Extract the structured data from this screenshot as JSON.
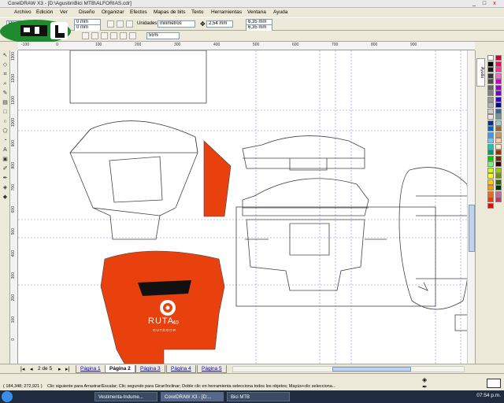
{
  "window": {
    "title": "CorelDRAW X3 - [D:\\Agustin\\Bici MTB\\ALFORIAS.cdr]",
    "minimize": "_",
    "maximize": "□",
    "close": "x"
  },
  "menu": [
    "Archivo",
    "Edición",
    "Ver",
    "Diseño",
    "Organizar",
    "Efectos",
    "Mapas de bits",
    "Texto",
    "Herramientas",
    "Ventana",
    "Ayuda"
  ],
  "property_bar": {
    "preset_label": "Person",
    "width_value": "0 mm",
    "height_value": "0 mm",
    "units_label": "Unidades:",
    "units_value": "milímetros",
    "nudge_value": "2,54 mm",
    "dup_x": "6,35 mm",
    "dup_y": "6,35 mm",
    "zoom_value": "55%"
  },
  "hruler_ticks": [
    "-100",
    "0",
    "100",
    "200",
    "300",
    "400",
    "500",
    "600",
    "700",
    "800",
    "900"
  ],
  "vruler_ticks": [
    "1300",
    "1200",
    "1100",
    "1000",
    "900",
    "800",
    "700",
    "600",
    "500",
    "400",
    "300",
    "200",
    "100",
    "0"
  ],
  "artwork": {
    "logo_text": "RUTA",
    "logo_sub": "OUTDOOR",
    "logo_num": "40",
    "accent": "#e8410d"
  },
  "docker": {
    "tab_label": "Ayuda"
  },
  "pages": {
    "counter": "2 de 5",
    "tabs": [
      "Página 1",
      "Página 2",
      "Página 3",
      "Página 4",
      "Página 5"
    ],
    "active": 1
  },
  "status": {
    "coords": "( 184,348; 272,921 )",
    "hint": "Clic siguiente para Arrastrar/Escalar; Clic segundo para Girar/Inclinar; Doble clic en herramienta selecciona todos los objetos; Mayús+clic selecciona..."
  },
  "taskbar": {
    "items": [
      "Vestimenta-Indume...",
      "CorelDRAW X3 - [D:...",
      "Bici MTB"
    ],
    "clock": "07:54 p.m."
  },
  "palette_colors": [
    "#ffffff",
    "#000000",
    "#1a1a1a",
    "#333333",
    "#4d4d4d",
    "#666666",
    "#808080",
    "#999999",
    "#b3b3b3",
    "#cccccc",
    "#e6e6e6",
    "#003399",
    "#0066cc",
    "#3399ff",
    "#66ccff",
    "#00cccc",
    "#009966",
    "#00cc00",
    "#66ff66",
    "#ccff00",
    "#ffff00",
    "#ffcc00",
    "#ff9900",
    "#ff6600",
    "#ff3300",
    "#ff0000",
    "#cc0033",
    "#ff0066",
    "#ff3399",
    "#ff66cc",
    "#cc00cc",
    "#9900cc",
    "#6600cc",
    "#3300cc",
    "#000099",
    "#336699",
    "#669999",
    "#99cccc",
    "#996633",
    "#cc9966",
    "#ffcc99",
    "#ffe6cc",
    "#993300",
    "#663300",
    "#330000",
    "#99cc00",
    "#669900",
    "#336600",
    "#003300",
    "#cc6699",
    "#cc3366"
  ]
}
